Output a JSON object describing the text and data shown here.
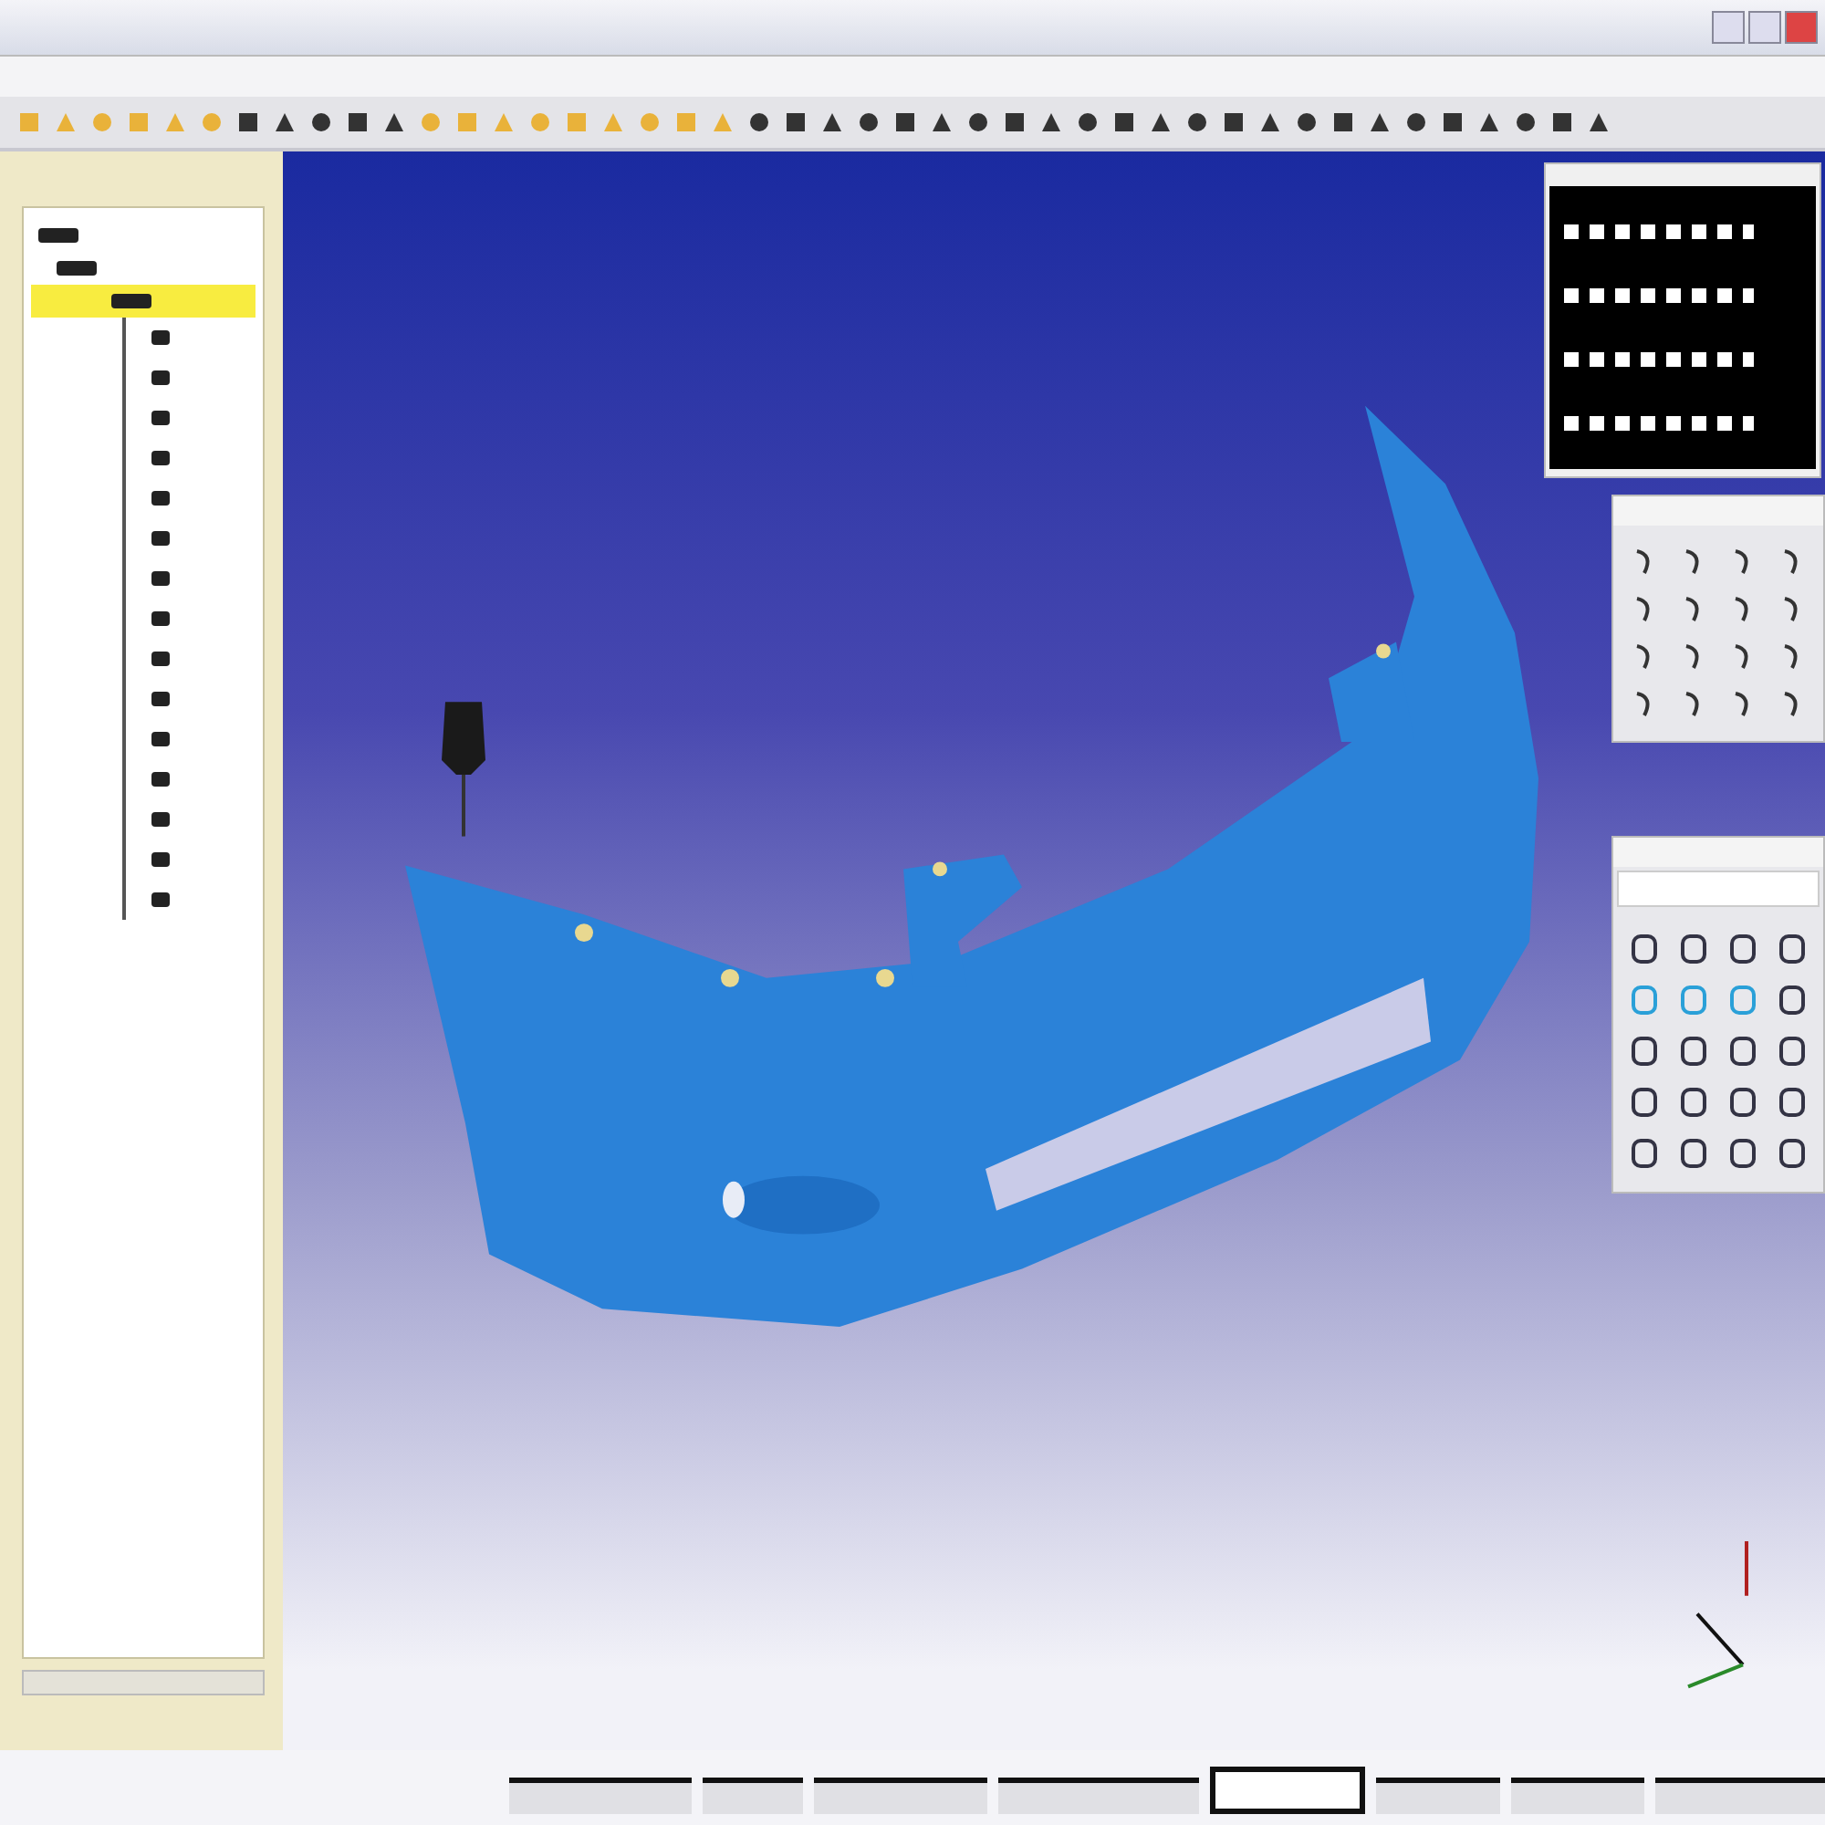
{
  "tree": [
    {
      "expanded": true,
      "selected": false,
      "children": [
        {
          "expanded": true,
          "selected": false,
          "children": [
            {
              "expanded": true,
              "selected": true,
              "children": [
                {
                  "selected": false
                },
                {
                  "selected": false
                },
                {
                  "selected": false
                },
                {
                  "selected": false
                },
                {
                  "selected": false
                },
                {
                  "selected": false
                },
                {
                  "selected": false
                },
                {
                  "selected": false
                },
                {
                  "selected": false
                },
                {
                  "selected": false
                },
                {
                  "selected": false
                },
                {
                  "selected": false
                },
                {
                  "selected": false
                },
                {
                  "selected": false
                },
                {
                  "selected": false
                }
              ]
            }
          ]
        }
      ]
    }
  ],
  "status_bar": {
    "panes": [
      {
        "selected": false
      },
      {
        "selected": false
      },
      {
        "selected": false
      },
      {
        "selected": false
      },
      {
        "selected": true
      },
      {
        "selected": false
      },
      {
        "selected": false
      },
      {
        "selected": false
      }
    ]
  }
}
